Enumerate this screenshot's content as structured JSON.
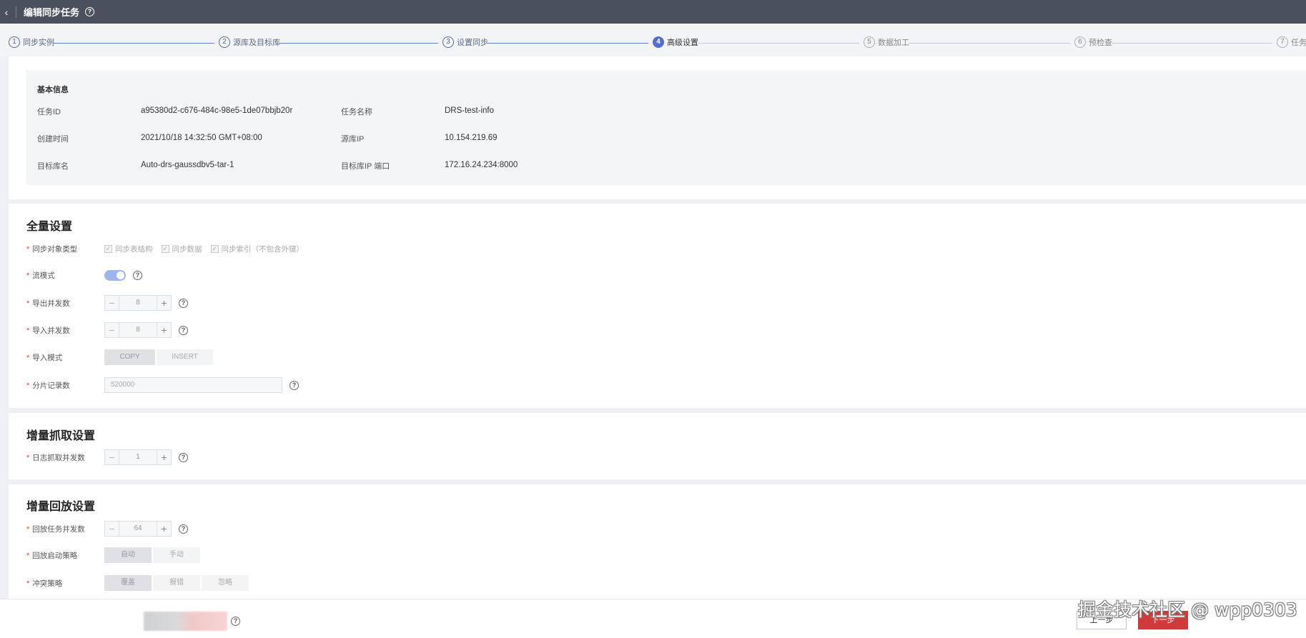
{
  "header": {
    "title": "编辑同步任务",
    "back_glyph": "‹",
    "help_glyph": "?"
  },
  "steps": [
    {
      "num": "1",
      "label": "同步实例",
      "state": "done"
    },
    {
      "num": "2",
      "label": "源库及目标库",
      "state": "done"
    },
    {
      "num": "3",
      "label": "设置同步",
      "state": "done"
    },
    {
      "num": "4",
      "label": "高级设置",
      "state": "active"
    },
    {
      "num": "5",
      "label": "数据加工",
      "state": "todo"
    },
    {
      "num": "6",
      "label": "预检查",
      "state": "todo"
    },
    {
      "num": "7",
      "label": "任务",
      "state": "todo"
    }
  ],
  "basic_info": {
    "title": "基本信息",
    "task_id_label": "任务ID",
    "task_id": "a95380d2-c676-484c-98e5-1de07bbjb20r",
    "task_name_label": "任务名称",
    "task_name": "DRS-test-info",
    "created_label": "创建时间",
    "created": "2021/10/18 14:32:50 GMT+08:00",
    "source_ip_label": "源库IP",
    "source_ip": "10.154.219.69",
    "target_db_label": "目标库名",
    "target_db": "Auto-drs-gaussdbv5-tar-1",
    "target_ip_label": "目标库IP 端口",
    "target_ip": "172.16.24.234:8000"
  },
  "full_settings": {
    "title": "全量设置",
    "object_type_label": "同步对象类型",
    "object_types": [
      "同步表结构",
      "同步数据",
      "同步索引（不包含外键）"
    ],
    "stream_mode_label": "流模式",
    "export_concurrency_label": "导出并发数",
    "export_concurrency": "8",
    "import_concurrency_label": "导入并发数",
    "import_concurrency": "8",
    "import_mode_label": "导入模式",
    "import_modes": [
      "COPY",
      "INSERT"
    ],
    "shard_records_label": "分片记录数",
    "shard_records": "520000"
  },
  "incremental_grab": {
    "title": "增量抓取设置",
    "log_concurrency_label": "日志抓取并发数",
    "log_concurrency": "1"
  },
  "incremental_replay": {
    "title": "增量回放设置",
    "replay_concurrency_label": "回放任务并发数",
    "replay_concurrency": "64",
    "start_strategy_label": "回放启动策略",
    "start_strategies": [
      "自动",
      "手动"
    ],
    "conflict_label": "冲突策略",
    "conflict_options": [
      "覆盖",
      "报错",
      "忽略"
    ]
  },
  "footer": {
    "prev_label": "上一步",
    "next_label": "下一步"
  },
  "watermark": "掘金技术社区 @ wpp0303",
  "colors": {
    "header_bg": "#4a505c",
    "accent": "#526ecc",
    "required": "#e0433a",
    "next_button": "#d13a3a"
  },
  "icons": {
    "check": "✓",
    "minus": "−",
    "plus": "+",
    "question": "?"
  }
}
